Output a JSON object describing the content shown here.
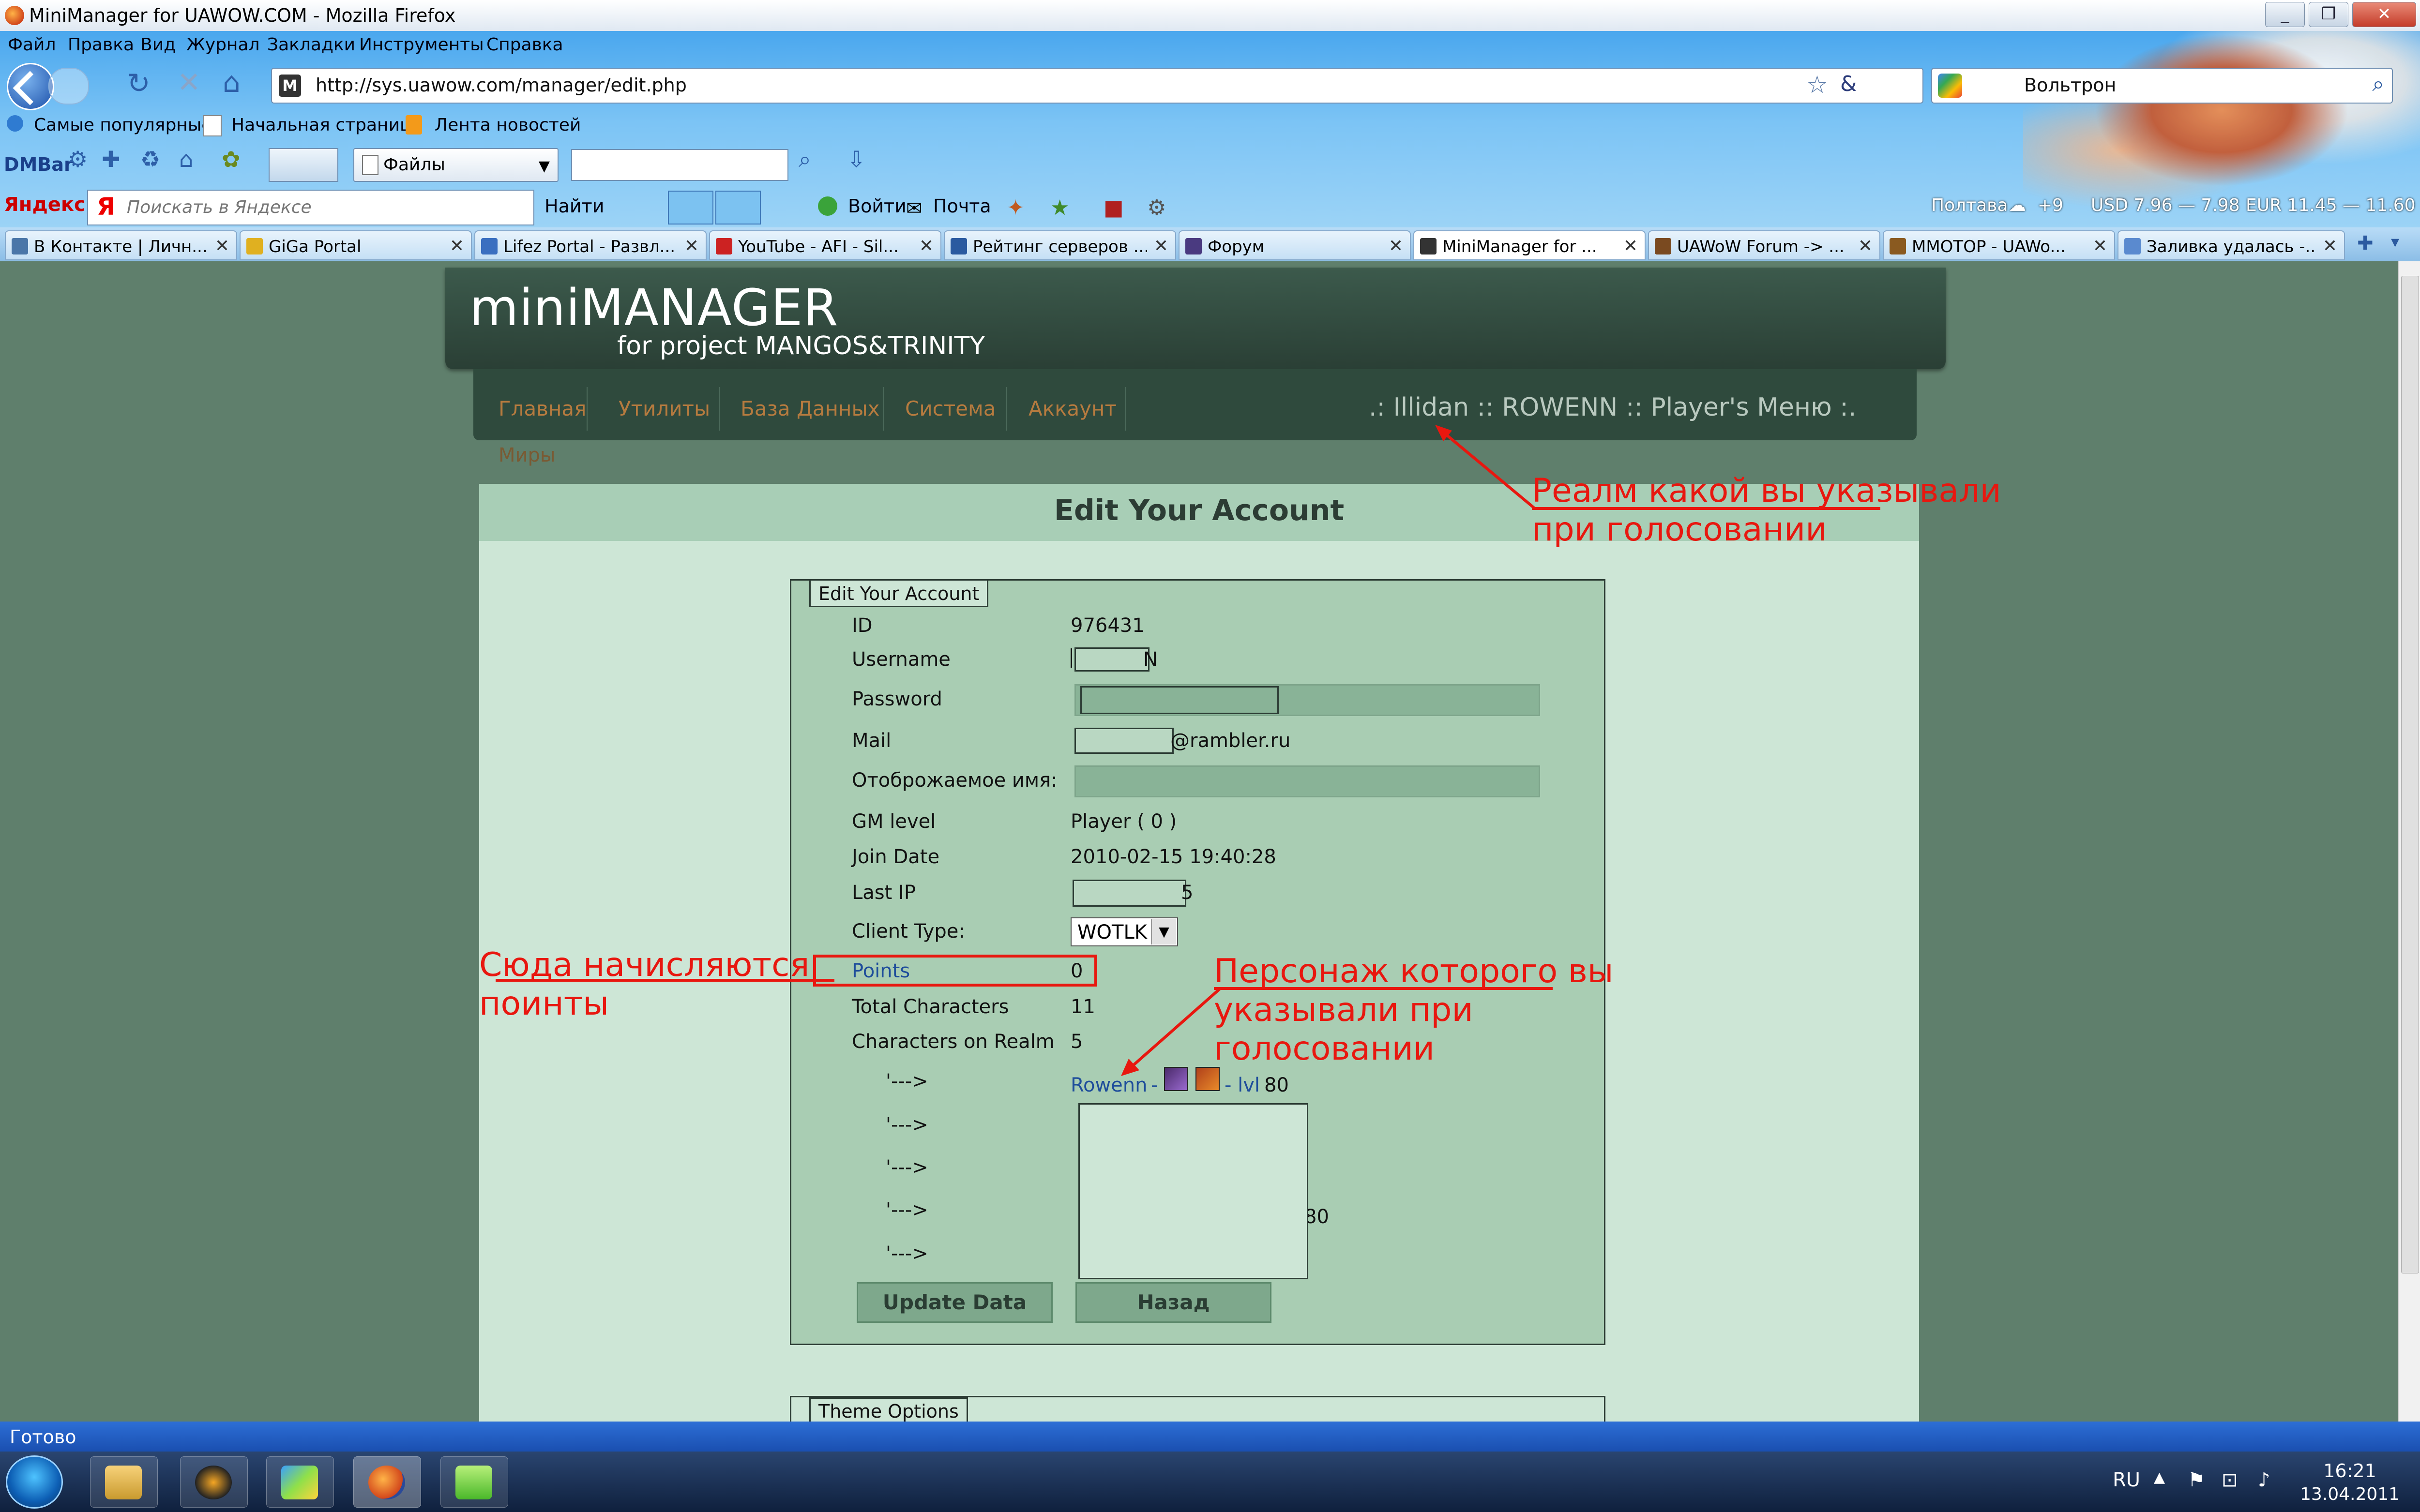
{
  "window": {
    "title": "MiniManager for UAWOW.COM - Mozilla Firefox"
  },
  "menu": [
    "Файл",
    "Правка",
    "Вид",
    "Журнал",
    "Закладки",
    "Инструменты",
    "Справка"
  ],
  "navbar": {
    "url": "http://sys.uawow.com/manager/edit.php",
    "search_engine_text": "Вольтрон"
  },
  "bookmarks": [
    "Самые популярные",
    "Начальная страница",
    "Лента новостей"
  ],
  "dmbar": {
    "label": "DMBar",
    "files_label": "Файлы"
  },
  "yandexbar": {
    "logo": "Яндекс",
    "search_placeholder": "Поискать в Яндексе",
    "find_label": "Найти",
    "login_label": "Войти",
    "mail_label": "Почта",
    "city": "Полтава",
    "temp": "+9",
    "usd": "USD 7.96 — 7.98",
    "eur": "EUR 11.45 — 11.60"
  },
  "tabs": [
    {
      "label": "В Контакте | Личн...",
      "color": "#4a76a8"
    },
    {
      "label": "GiGa Portal",
      "color": "#e0b020"
    },
    {
      "label": "Lifez Portal - Развл...",
      "color": "#3a6fc0"
    },
    {
      "label": "YouTube - AFI - Sil...",
      "color": "#cc2222"
    },
    {
      "label": "Рейтинг серверов ...",
      "color": "#2a5aa0"
    },
    {
      "label": "Форум",
      "color": "#4a3a80"
    },
    {
      "label": "MiniManager for ...",
      "color": "#333333"
    },
    {
      "label": "UAWoW Forum -> ...",
      "color": "#7a4a20"
    },
    {
      "label": "MMOTOP - UAWo...",
      "color": "#8a5a20"
    },
    {
      "label": "Заливка удалась -...",
      "color": "#5a8acf"
    }
  ],
  "page": {
    "brand_title": "miniMANAGER",
    "brand_subtitle": "for project MANGOS&TRINITY",
    "nav": [
      "Главная",
      "Утилиты",
      "База Данных",
      "Система",
      "Аккаунт"
    ],
    "nav_mirrors": "Миры",
    "realm_path": ".: Illidan :: ROWENN :: Player's Меню :.",
    "panel_title": "Edit Your Account",
    "legend": "Edit Your Account",
    "fields": {
      "id_label": "ID",
      "id_value": "976431",
      "username_label": "Username",
      "username_value": "N",
      "password_label": "Password",
      "mail_label": "Mail",
      "mail_value": "@rambler.ru",
      "display_name_label": "Отоброжаемое имя:",
      "gm_label": "GM level",
      "gm_value": "Player ( 0 )",
      "join_label": "Join Date",
      "join_value": "2010-02-15 19:40:28",
      "ip_label": "Last IP",
      "ip_value": "5",
      "client_label": "Client Type:",
      "client_value": "WOTLK",
      "points_label": "Points",
      "points_value": "0",
      "total_chars_label": "Total Characters",
      "total_chars_value": "11",
      "realm_chars_label": "Characters on Realm",
      "realm_chars_value": "5"
    },
    "characters": {
      "arrow": "'--->",
      "first_name": "Rowenn",
      "first_sep": "-",
      "first_lvl_label": "- lvl",
      "first_lvl_value": "80",
      "partial_4": "80"
    },
    "buttons": {
      "update": "Update Data",
      "back": "Назад"
    },
    "theme_legend": "Theme Options"
  },
  "annotations": {
    "realm_note": "Реалм какой  вы указывали при голосовании",
    "points_note": "Сюда начисляются поинты",
    "char_note": "Персонаж которого вы указывали при голосовании"
  },
  "status": {
    "text": "Готово"
  },
  "taskbar": {
    "lang": "RU",
    "time": "16:21",
    "date": "13.04.2011"
  }
}
